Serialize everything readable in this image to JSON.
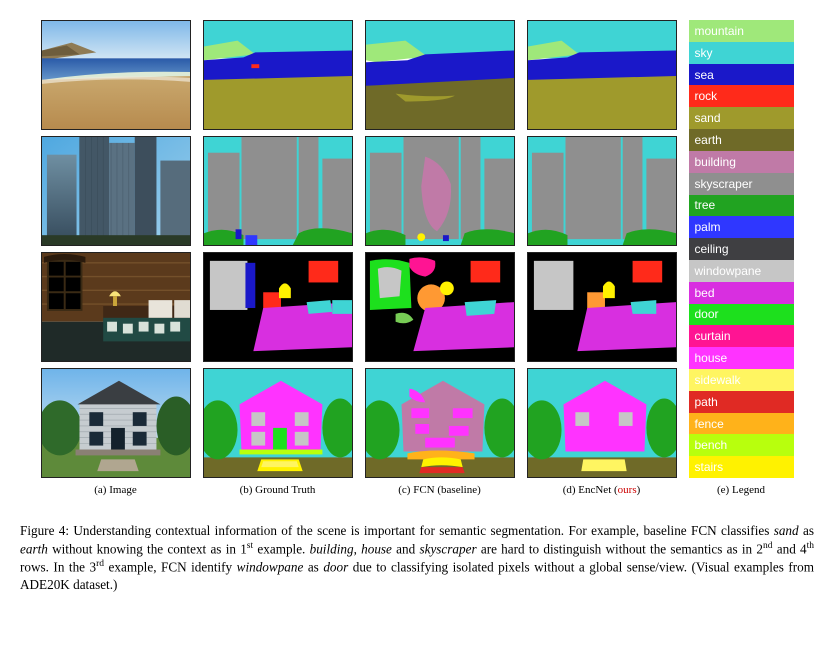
{
  "columns": {
    "a": "(a) Image",
    "b": "(b) Ground Truth",
    "c_pre": "(c) FCN (",
    "c_mid": "baseline",
    "c_post": ")",
    "d_pre": "(d) EncNet (",
    "d_mid": "ours",
    "d_post": ")",
    "e": "(e) Legend"
  },
  "legend": [
    {
      "label": "mountain",
      "color": "#9fe87a"
    },
    {
      "label": "sky",
      "color": "#3fd4d4"
    },
    {
      "label": "sea",
      "color": "#1a18c9"
    },
    {
      "label": "rock",
      "color": "#ff2a1a"
    },
    {
      "label": "sand",
      "color": "#9f9a2c"
    },
    {
      "label": "earth",
      "color": "#6f6a28"
    },
    {
      "label": "building",
      "color": "#c07aa7"
    },
    {
      "label": "skyscraper",
      "color": "#8f8f8f"
    },
    {
      "label": "tree",
      "color": "#21a321"
    },
    {
      "label": "palm",
      "color": "#2f37ff"
    },
    {
      "label": "ceiling",
      "color": "#3f3f42"
    },
    {
      "label": "windowpane",
      "color": "#c6c6c6"
    },
    {
      "label": "bed",
      "color": "#d82fe0"
    },
    {
      "label": "door",
      "color": "#1de01d"
    },
    {
      "label": "curtain",
      "color": "#ff1493"
    },
    {
      "label": "house",
      "color": "#ff33ff"
    },
    {
      "label": "sidewalk",
      "color": "#fff561"
    },
    {
      "label": "path",
      "color": "#e02a24"
    },
    {
      "label": "fence",
      "color": "#ffb21a"
    },
    {
      "label": "bench",
      "color": "#b8ff0d"
    },
    {
      "label": "stairs",
      "color": "#fff200"
    }
  ],
  "caption": {
    "figno": "Figure 4:",
    "t1": " Understanding contextual information of the scene is important for semantic segmentation. For example, baseline FCN classifies ",
    "i1": "sand",
    "t2": " as ",
    "i2": "earth",
    "t3": " without knowing the context as in 1",
    "sup1": "st",
    "t4": " example. ",
    "i3": "building",
    "t5": ", ",
    "i4": "house",
    "t6": " and ",
    "i5": "skyscraper",
    "t7": " are hard to distinguish without the semantics as in 2",
    "sup2": "nd",
    "t8": " and 4",
    "sup3": "th",
    "t9": " rows. In the 3",
    "sup4": "rd",
    "t10": " example, FCN identify ",
    "i6": "windowpane",
    "t11": " as ",
    "i7": "door",
    "t12": " due to classifying isolated pixels without a global sense/view. (Visual examples from ADE20K dataset.)"
  }
}
